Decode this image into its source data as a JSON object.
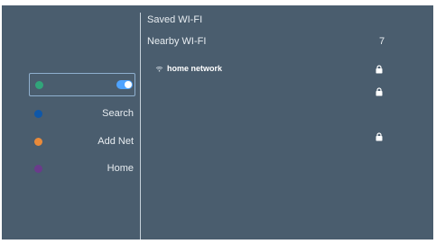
{
  "sidebar": {
    "items": [
      {
        "label": "",
        "dot_color": "#31a57a",
        "selected": true,
        "toggle_on": true
      },
      {
        "label": "Search",
        "dot_color": "#0f57a8"
      },
      {
        "label": "Add Net",
        "dot_color": "#e98a3a"
      },
      {
        "label": "Home",
        "dot_color": "#6a3b8b"
      }
    ]
  },
  "main": {
    "saved_label": "Saved WI-FI",
    "nearby_label": "Nearby WI-FI",
    "nearby_count": "7",
    "networks": [
      {
        "name": "home network",
        "locked": true
      }
    ]
  },
  "colors": {
    "background": "#4a5d6e",
    "accent": "#4ea3ff"
  }
}
